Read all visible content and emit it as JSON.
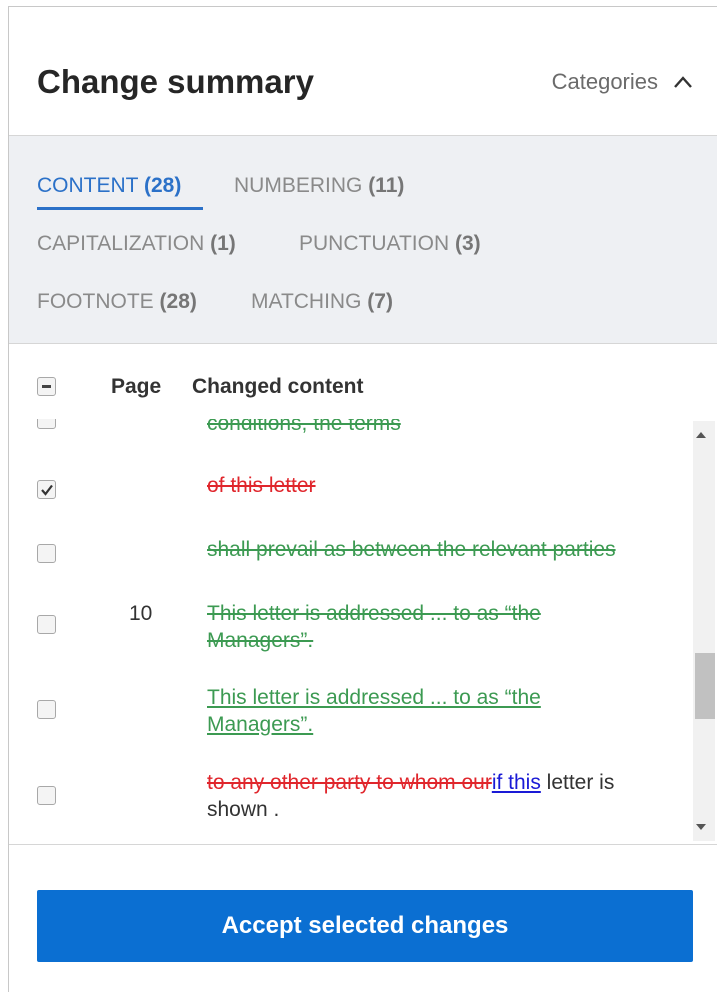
{
  "header": {
    "title": "Change summary",
    "categories_label": "Categories"
  },
  "tabs": [
    {
      "name": "CONTENT",
      "count": "(28)",
      "active": true
    },
    {
      "name": "NUMBERING",
      "count": "(11)",
      "active": false
    },
    {
      "name": "CAPITALIZATION",
      "count": "(1)",
      "active": false
    },
    {
      "name": "PUNCTUATION",
      "count": "(3)",
      "active": false
    },
    {
      "name": "FOOTNOTE",
      "count": "(28)",
      "active": false
    },
    {
      "name": "MATCHING",
      "count": "(7)",
      "active": false
    }
  ],
  "table": {
    "col_page": "Page",
    "col_changed": "Changed content",
    "rows": [
      {
        "page": "",
        "checked": false,
        "text": "conditions, the terms"
      },
      {
        "page": "",
        "checked": true,
        "text": "of this letter"
      },
      {
        "page": "",
        "checked": false,
        "text": "shall prevail as between the relevant parties"
      },
      {
        "page": "10",
        "checked": false,
        "line1": "This letter is addressed ... to as “the",
        "line2": "Managers”."
      },
      {
        "page": "",
        "checked": false,
        "line1": "This letter is addressed ... to as “the",
        "line2": "Managers”."
      },
      {
        "page": "",
        "checked": false,
        "del": "to any other party to whom our",
        "ins": "if this",
        "tail": " letter is",
        "line2": "shown ."
      }
    ]
  },
  "footer": {
    "accept_label": "Accept selected changes"
  },
  "colors": {
    "accent": "#2b71c8",
    "button": "#0b6fd2",
    "insert_green": "#3c9a52",
    "delete_red": "#e0262c",
    "insert_blue": "#1a1ad6"
  },
  "icons": {
    "categories_toggle": "chevron-up-icon",
    "checked": "check-icon"
  }
}
